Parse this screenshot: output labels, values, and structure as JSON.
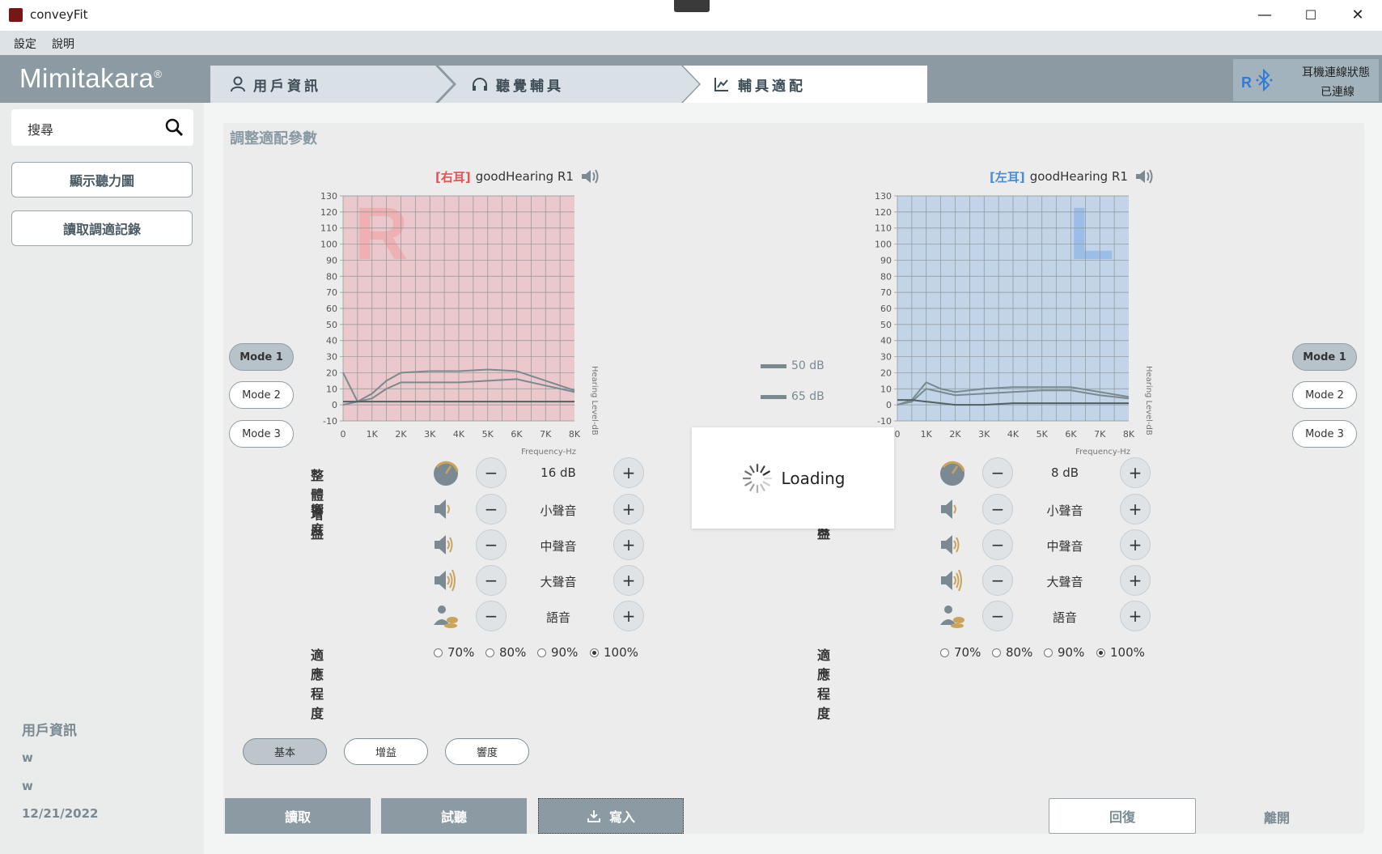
{
  "window": {
    "title": "conveyFit",
    "minimize": "—",
    "maximize": "☐",
    "close": "✕"
  },
  "menu": {
    "settings": "設定",
    "help": "說明"
  },
  "header": {
    "logo": "Mimitakara",
    "logo_mark": "®",
    "tabs": [
      {
        "label": "用戶資訊",
        "icon": "user-icon"
      },
      {
        "label": "聽覺輔具",
        "icon": "headphones-icon"
      },
      {
        "label": "輔具適配",
        "icon": "chart-icon"
      }
    ],
    "connection": {
      "title": "耳機連線狀態",
      "status": "已連線",
      "side": "R",
      "icon": "bluetooth-icon"
    }
  },
  "sidebar": {
    "search_placeholder": "搜尋",
    "show_audiogram": "顯示聽力圖",
    "read_records": "讀取調適記錄",
    "user_info_title": "用戶資訊",
    "user_name": "w",
    "user_id": "w",
    "date": "12/21/2022"
  },
  "main": {
    "heading": "調整適配參數",
    "legend": {
      "item1": "50 dB",
      "item2": "65 dB"
    },
    "modes": [
      "Mode 1",
      "Mode 2",
      "Mode 3"
    ],
    "labels": {
      "overall_gain": "整體增益",
      "loudness": "響度",
      "adaptation": "適應程度"
    },
    "loudness_levels": [
      "小聲音",
      "中聲音",
      "大聲音",
      "語音"
    ],
    "adaptation_options": [
      "70%",
      "80%",
      "90%",
      "100%"
    ],
    "minus": "−",
    "plus": "+",
    "right": {
      "tag": "[右耳]",
      "device": "goodHearing R1",
      "letter": "R",
      "gain": "16 dB",
      "adaptation_selected": "100%",
      "active_mode": "Mode 1",
      "color": "#e07070"
    },
    "left": {
      "tag": "[左耳]",
      "device": "goodHearing R1",
      "letter": "L",
      "gain": "8 dB",
      "adaptation_selected": "100%",
      "active_mode": "Mode 1",
      "color": "#5a9ad6"
    },
    "subtabs": [
      "基本",
      "增益",
      "響度"
    ],
    "buttons": {
      "read": "讀取",
      "listen": "試聽",
      "write": "寫入",
      "restore": "回復",
      "leave": "離開"
    },
    "loading": "Loading"
  },
  "chart_data": [
    {
      "type": "line",
      "title": "[右耳] goodHearing R1",
      "xlabel": "Frequency-Hz",
      "ylabel": "Hearing Level-dB",
      "x": [
        0,
        500,
        1000,
        1500,
        2000,
        3000,
        4000,
        5000,
        6000,
        7000,
        8000
      ],
      "xticks": [
        "0",
        "1K",
        "2K",
        "3K",
        "4K",
        "5K",
        "6K",
        "7K",
        "8K"
      ],
      "yticks": [
        -10,
        0,
        10,
        20,
        30,
        40,
        50,
        60,
        70,
        80,
        90,
        100,
        110,
        120,
        130
      ],
      "ylim": [
        -10,
        130
      ],
      "xlim": [
        0,
        8000
      ],
      "grid": true,
      "bg": "#eac8cb",
      "series": [
        {
          "values": [
            20,
            2,
            7,
            15,
            20,
            21,
            21,
            22,
            21,
            15,
            9
          ],
          "color": "#7a8a8f"
        },
        {
          "values": [
            0,
            2,
            4,
            10,
            14,
            14,
            14,
            15,
            16,
            12,
            8
          ],
          "color": "#7a8a8f"
        },
        {
          "values": [
            2,
            2,
            2,
            2,
            2,
            2,
            2,
            2,
            2,
            2,
            2
          ],
          "color": "#555f63"
        }
      ]
    },
    {
      "type": "line",
      "title": "[左耳] goodHearing R1",
      "xlabel": "Frequency-Hz",
      "ylabel": "Hearing Level-dB",
      "x": [
        0,
        500,
        1000,
        1500,
        2000,
        3000,
        4000,
        5000,
        6000,
        7000,
        8000
      ],
      "xticks": [
        "0",
        "1K",
        "2K",
        "3K",
        "4K",
        "5K",
        "6K",
        "7K",
        "8K"
      ],
      "yticks": [
        -10,
        0,
        10,
        20,
        30,
        40,
        50,
        60,
        70,
        80,
        90,
        100,
        110,
        120,
        130
      ],
      "ylim": [
        -10,
        130
      ],
      "xlim": [
        0,
        8000
      ],
      "grid": true,
      "bg": "#c2d4e8",
      "series": [
        {
          "values": [
            0,
            3,
            14,
            10,
            8,
            10,
            11,
            11,
            11,
            8,
            5
          ],
          "color": "#7a8a8f"
        },
        {
          "values": [
            0,
            2,
            10,
            8,
            6,
            7,
            8,
            9,
            9,
            6,
            4
          ],
          "color": "#7a8a8f"
        },
        {
          "values": [
            3,
            3,
            2,
            1,
            0,
            0,
            1,
            1,
            1,
            1,
            1
          ],
          "color": "#555f63"
        }
      ]
    }
  ]
}
